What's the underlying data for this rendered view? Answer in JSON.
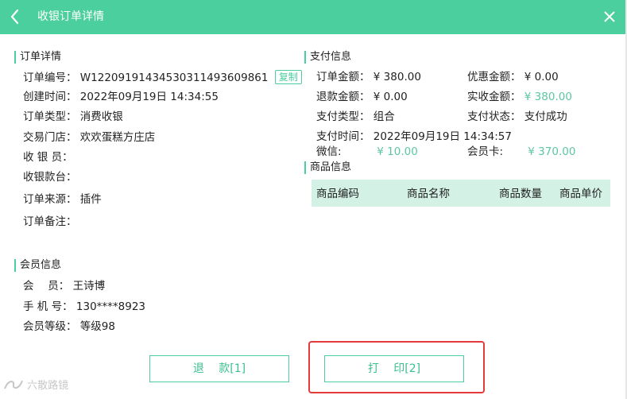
{
  "window": {
    "title": "收银订单详情",
    "accent_color": "#4ccf9e",
    "back_icon": "chevron-left-icon",
    "close_icon": "close-icon"
  },
  "order": {
    "section_title": "订单详情",
    "number_label": "订单编号：",
    "number_value": "W12209191434530311493609861",
    "copy_label": "复制",
    "created_label": "创建时间：",
    "created_value": "2022年09月19日 14:34:55",
    "type_label": "订单类型：",
    "type_value": "消费收银",
    "store_label": "交易门店：",
    "store_value": "欢欢蛋糕方庄店",
    "cashier_label": "收 银 员：",
    "cashier_value": "",
    "counter_label": "收银款台：",
    "counter_value": "",
    "source_label": "订单来源：",
    "source_value": "插件",
    "remark_label": "订单备注：",
    "remark_value": ""
  },
  "member": {
    "section_title": "会员信息",
    "name_label": "会　 员：",
    "name_value": "王诗博",
    "phone_label": "手 机 号：",
    "phone_value": "130****8923",
    "level_label": "会员等级：",
    "level_value": "等级98"
  },
  "payment": {
    "section_title": "支付信息",
    "amount_label": "订单金额：",
    "amount_value": "¥ 380.00",
    "discount_label": "优惠金额：",
    "discount_value": "¥ 0.00",
    "refund_label": "退款金额：",
    "refund_value": "¥ 0.00",
    "received_label": "实收金额：",
    "received_value": "¥ 380.00",
    "paytype_label": "支付类型：",
    "paytype_value": "组合",
    "status_label": "支付状态：",
    "status_value": "支付成功",
    "paytime_label": "支付时间：",
    "paytime_value": "2022年09月19日 14:34:57",
    "wechat_label": "微信:",
    "wechat_value": "¥ 10.00",
    "card_label": "会员卡:",
    "card_value": "¥ 370.00"
  },
  "goods": {
    "section_title": "商品信息",
    "columns": [
      "商品编码",
      "商品名称",
      "商品数量",
      "商品单价"
    ]
  },
  "actions": {
    "refund_label": "退　 款[1]",
    "print_label": "打　 印[2]"
  },
  "watermark": {
    "text": "六散路镜"
  }
}
